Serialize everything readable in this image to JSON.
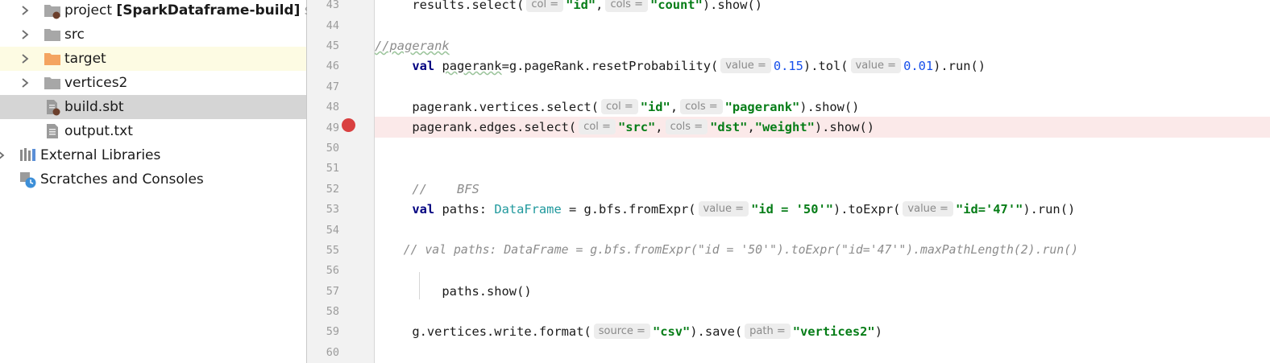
{
  "project_tree": {
    "items": [
      {
        "label": "project",
        "extra": "[SparkDataframe-build]",
        "suffix": "sou"
      },
      {
        "label": "src"
      },
      {
        "label": "target"
      },
      {
        "label": "vertices2"
      },
      {
        "label": "build.sbt"
      },
      {
        "label": "output.txt"
      },
      {
        "label": "External Libraries"
      },
      {
        "label": "Scratches and Consoles"
      }
    ]
  },
  "editor": {
    "line_numbers": [
      "43",
      "44",
      "45",
      "46",
      "47",
      "48",
      "49",
      "50",
      "51",
      "52",
      "53",
      "54",
      "55",
      "56",
      "57",
      "58",
      "59",
      "60"
    ],
    "breakpoint_line": "49",
    "hints": {
      "col": "col =",
      "cols": "cols =",
      "value": "value =",
      "source": "source =",
      "path": "path ="
    },
    "l43": {
      "a": "results.select(",
      "s1": "\"id\"",
      "b": ",",
      "s2": "\"count\"",
      "c": ").show()"
    },
    "l45": {
      "comment": "//pagerank"
    },
    "l46": {
      "kw": "val",
      "ident": "pagerank",
      "a": "=g.pageRank.resetProbability(",
      "n1": "0.15",
      "b": ").tol(",
      "n2": "0.01",
      "c": ").run()"
    },
    "l48": {
      "a": "pagerank.vertices.select(",
      "s1": "\"id\"",
      "b": ",",
      "s2": "\"pagerank\"",
      "c": ").show()"
    },
    "l49": {
      "a": "pagerank.edges.select(",
      "s1": "\"src\"",
      "b": ",",
      "s2": "\"dst\"",
      "b2": ",",
      "s3": "\"weight\"",
      "c": ").show()"
    },
    "l52": {
      "comment": "//    BFS"
    },
    "l53": {
      "kw": "val",
      "a": "paths: ",
      "type": "DataFrame",
      "b": " = g.bfs.fromExpr(",
      "s1": "\"id = '50'\"",
      "c": ").toExpr(",
      "s2": "\"id='47'\"",
      "d": ").run()"
    },
    "l55": {
      "comment": "// val paths: DataFrame = g.bfs.fromExpr(\"id = '50'\").toExpr(\"id='47'\").maxPathLength(2).run()"
    },
    "l57": {
      "a": "paths.show()"
    },
    "l59": {
      "a": "g.vertices.write.format(",
      "s1": "\"csv\"",
      "b": ").save(",
      "s2": "\"vertices2\"",
      "c": ")"
    }
  },
  "colors": {
    "keyword": "#000080",
    "string": "#067d17",
    "number": "#1750eb",
    "type": "#20999d",
    "comment": "#8c8c8c",
    "breakpoint": "#d94040",
    "error_line_bg": "#fbe9e9",
    "selection_bg": "#d5d5d5"
  }
}
